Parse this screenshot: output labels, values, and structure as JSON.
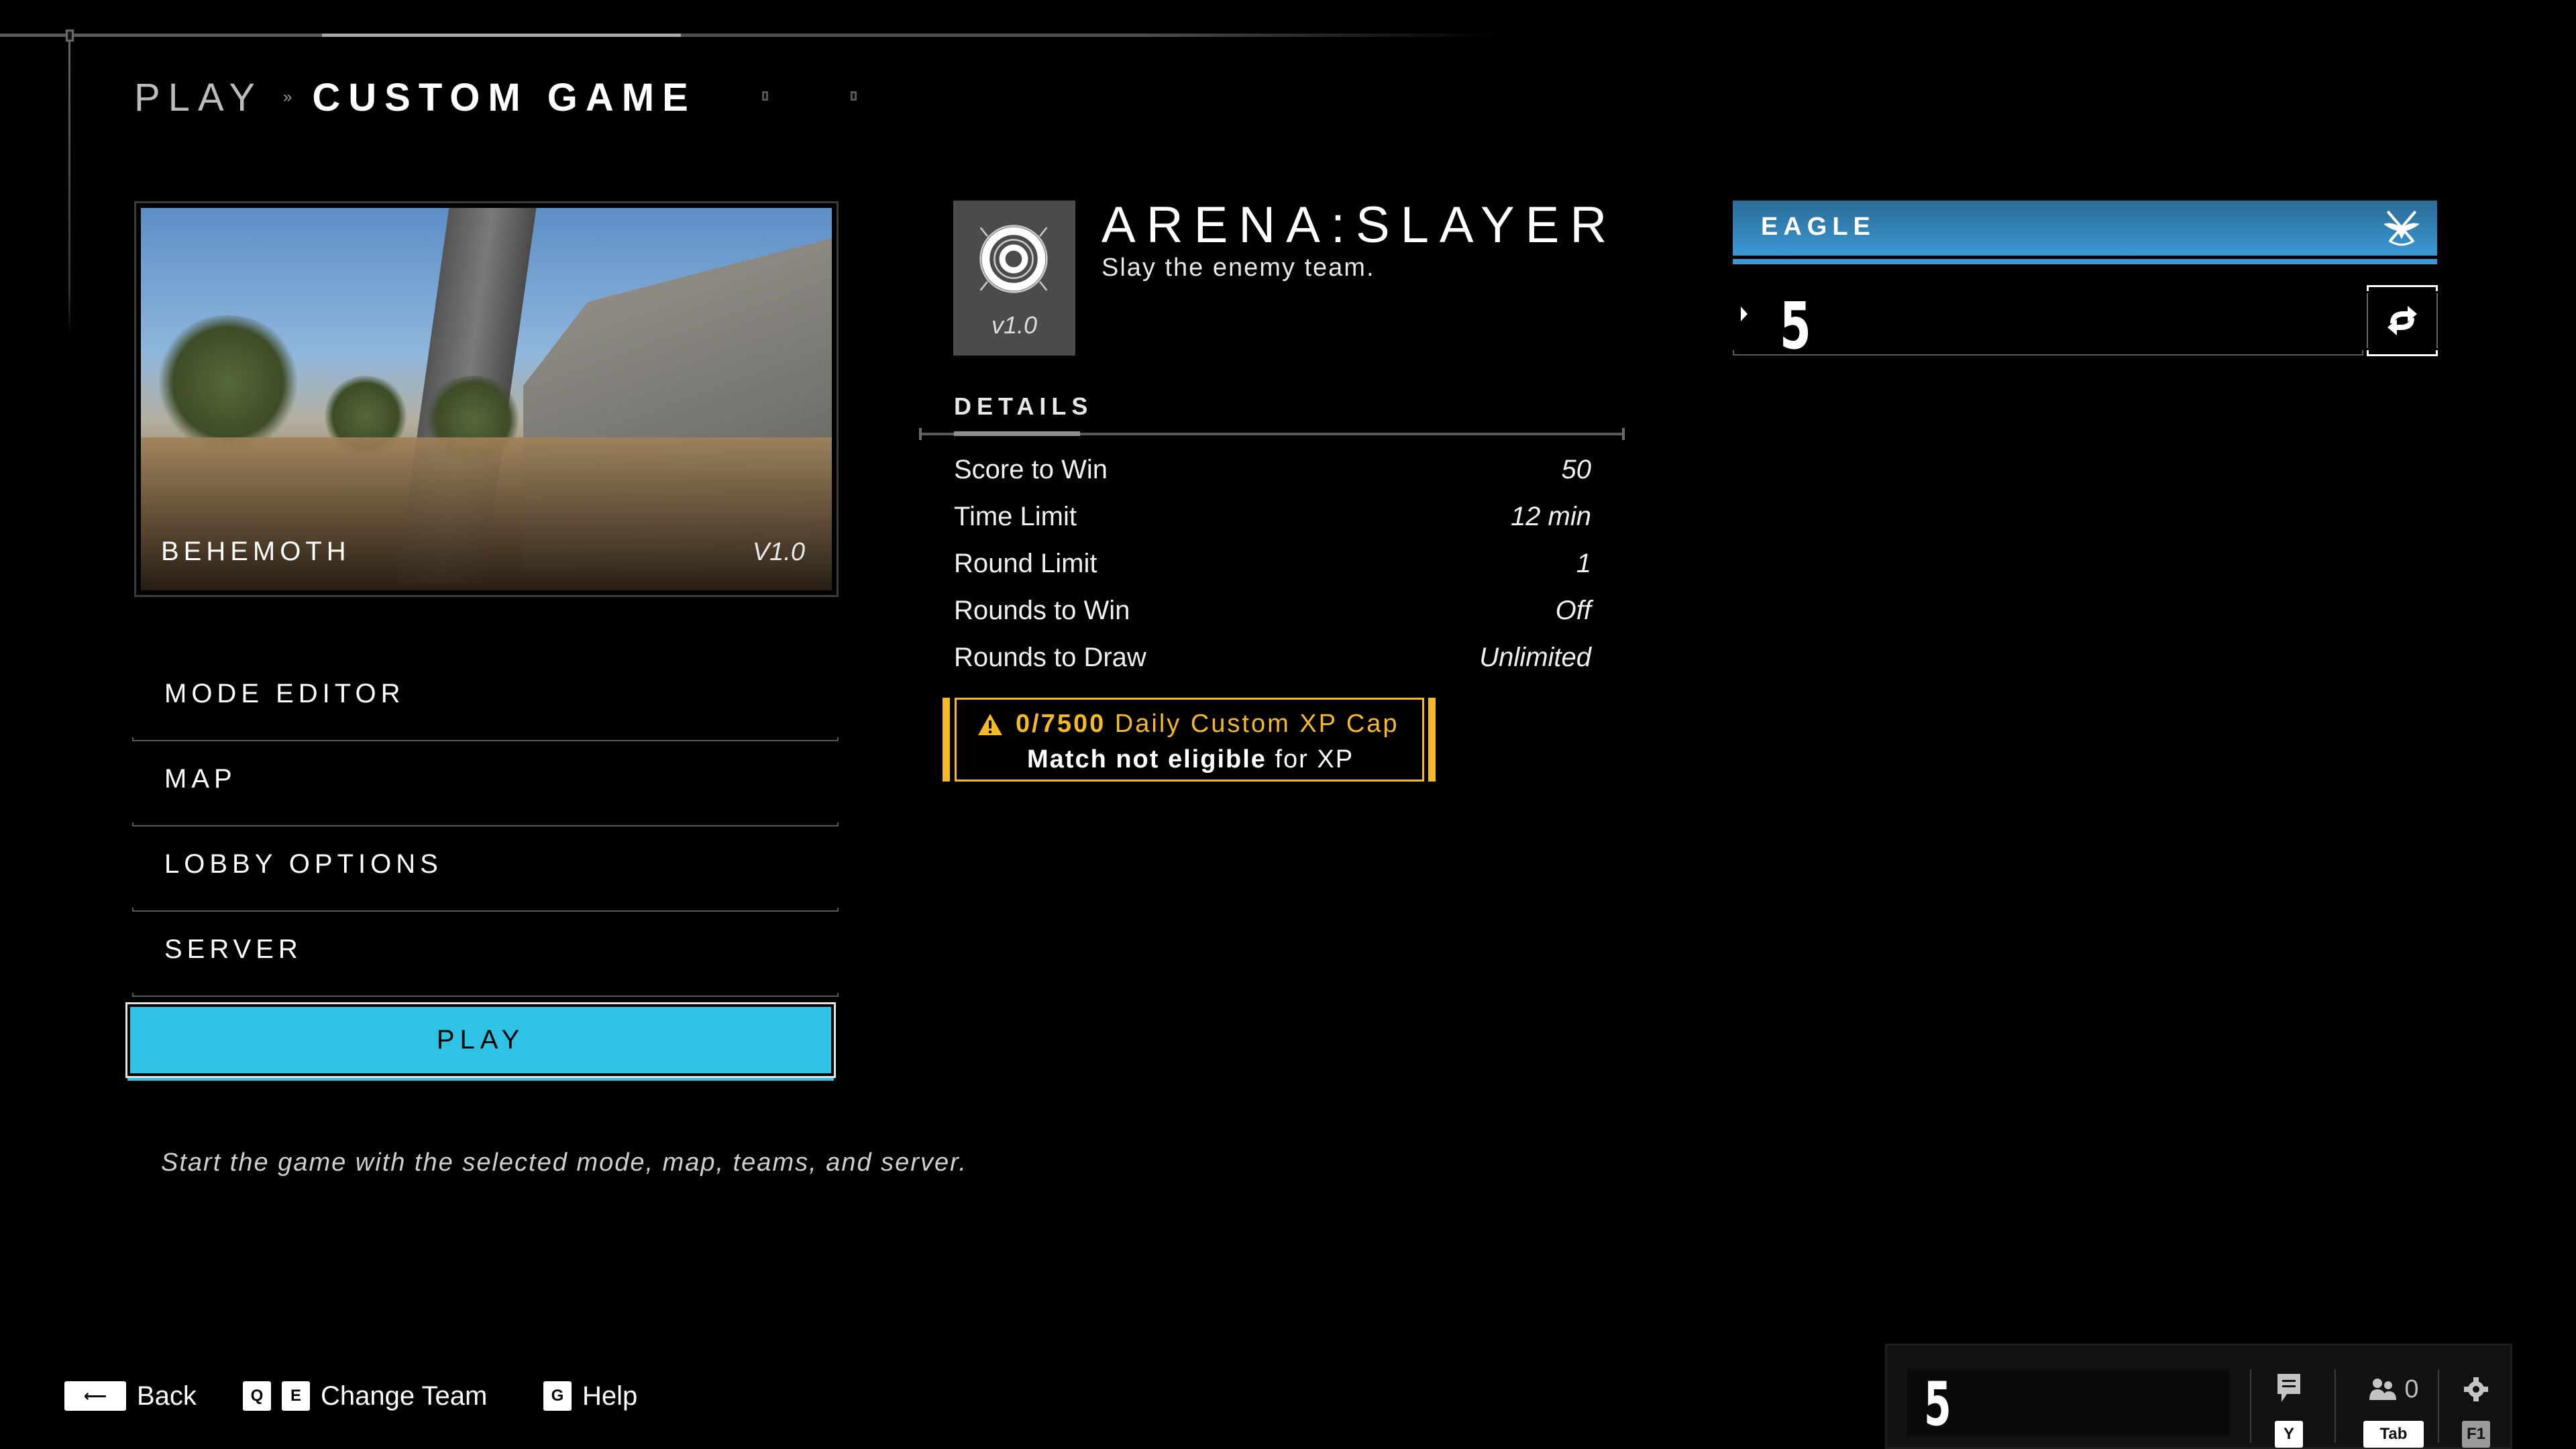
{
  "header": {
    "breadcrumb_root": "PLAY",
    "breadcrumb_separator_icon": "chevron-right-icon",
    "page_title": "CUSTOM GAME"
  },
  "map": {
    "name": "BEHEMOTH",
    "version": "V1.0"
  },
  "menu": {
    "items": [
      {
        "label": "MODE EDITOR"
      },
      {
        "label": "MAP"
      },
      {
        "label": "LOBBY OPTIONS"
      },
      {
        "label": "SERVER"
      }
    ],
    "play_label": "PLAY",
    "description": "Start the game with the selected mode, map, teams, and server."
  },
  "mode": {
    "icon": "slayer-target-icon",
    "version": "v1.0",
    "title": "ARENA:SLAYER",
    "subtitle": "Slay the enemy team."
  },
  "details": {
    "heading": "DETAILS",
    "rows": [
      {
        "label": "Score to Win",
        "value": "50"
      },
      {
        "label": "Time Limit",
        "value": "12 min"
      },
      {
        "label": "Round Limit",
        "value": "1"
      },
      {
        "label": "Rounds to Win",
        "value": "Off"
      },
      {
        "label": "Rounds to Draw",
        "value": "Unlimited"
      }
    ]
  },
  "xp_notice": {
    "icon": "warning-icon",
    "progress": "0/7500",
    "cap_label": "Daily Custom XP Cap",
    "eligibility_bold": "Match not eligible",
    "eligibility_rest": "for XP",
    "color": "#f5b922"
  },
  "team": {
    "name": "EAGLE",
    "emblem_icon": "eagle-swords-emblem-icon",
    "color": "#3b98d4",
    "player_emblem": "5",
    "swap_icon": "swap-team-icon"
  },
  "hints": [
    {
      "keys": [
        "⟵"
      ],
      "label": "Back"
    },
    {
      "keys": [
        "Q",
        "E"
      ],
      "label": "Change Team"
    },
    {
      "keys": [
        "G"
      ],
      "label": "Help"
    }
  ],
  "status_widget": {
    "player_emblem": "5",
    "chat_key": "Y",
    "party_count": "0",
    "party_key": "Tab",
    "settings_key": "F1"
  },
  "colors": {
    "play_button": "#2ec2e4",
    "background": "#000000"
  }
}
